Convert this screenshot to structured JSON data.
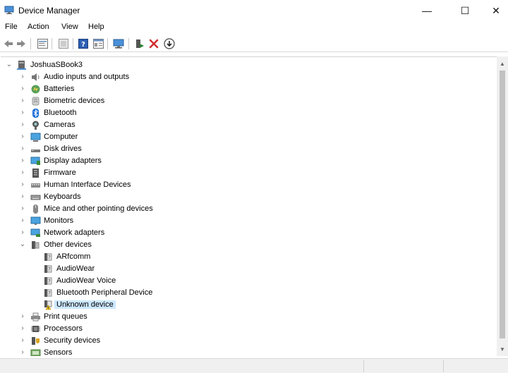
{
  "window": {
    "title": "Device Manager",
    "minimize_glyph": "—",
    "maximize_glyph": "☐",
    "close_glyph": "✕"
  },
  "menu": [
    "File",
    "Action",
    "View",
    "Help"
  ],
  "toolbar_icons": [
    "back-icon",
    "forward-icon",
    "properties-icon",
    "update-driver-icon",
    "help-icon",
    "show-hidden-icon",
    "scan-hardware-icon",
    "enable-device-icon",
    "uninstall-icon",
    "download-icon"
  ],
  "tree": {
    "root": "JoshuaSBook3",
    "expand_glyph": "›",
    "collapse_glyph": "⌄",
    "categories": [
      {
        "label": "Audio inputs and outputs",
        "icon": "speaker-icon"
      },
      {
        "label": "Batteries",
        "icon": "battery-icon"
      },
      {
        "label": "Biometric devices",
        "icon": "biometric-icon"
      },
      {
        "label": "Bluetooth",
        "icon": "bluetooth-icon"
      },
      {
        "label": "Cameras",
        "icon": "camera-icon"
      },
      {
        "label": "Computer",
        "icon": "computer-icon"
      },
      {
        "label": "Disk drives",
        "icon": "disk-drive-icon"
      },
      {
        "label": "Display adapters",
        "icon": "display-adapter-icon"
      },
      {
        "label": "Firmware",
        "icon": "firmware-icon"
      },
      {
        "label": "Human Interface Devices",
        "icon": "hid-icon"
      },
      {
        "label": "Keyboards",
        "icon": "keyboard-icon"
      },
      {
        "label": "Mice and other pointing devices",
        "icon": "mouse-icon"
      },
      {
        "label": "Monitors",
        "icon": "monitor-icon"
      },
      {
        "label": "Network adapters",
        "icon": "network-adapter-icon"
      },
      {
        "label": "Other devices",
        "icon": "other-devices-icon",
        "expanded": true
      },
      {
        "label": "Print queues",
        "icon": "printer-icon"
      },
      {
        "label": "Processors",
        "icon": "processor-icon"
      },
      {
        "label": "Security devices",
        "icon": "security-device-icon"
      },
      {
        "label": "Sensors",
        "icon": "sensor-icon"
      }
    ],
    "other_devices_children": [
      {
        "label": "ARfcomm",
        "icon": "unknown-device-icon"
      },
      {
        "label": "AudioWear",
        "icon": "unknown-device-icon"
      },
      {
        "label": "AudioWear Voice",
        "icon": "unknown-device-icon"
      },
      {
        "label": "Bluetooth Peripheral Device",
        "icon": "unknown-device-icon"
      },
      {
        "label": "Unknown device",
        "icon": "warning-device-icon",
        "selected": true
      }
    ]
  },
  "colors": {
    "selection": "#cce8ff",
    "accent_blue": "#1e88e5",
    "uninstall_red": "#d32f2f",
    "enable_green": "#2e7d32"
  }
}
